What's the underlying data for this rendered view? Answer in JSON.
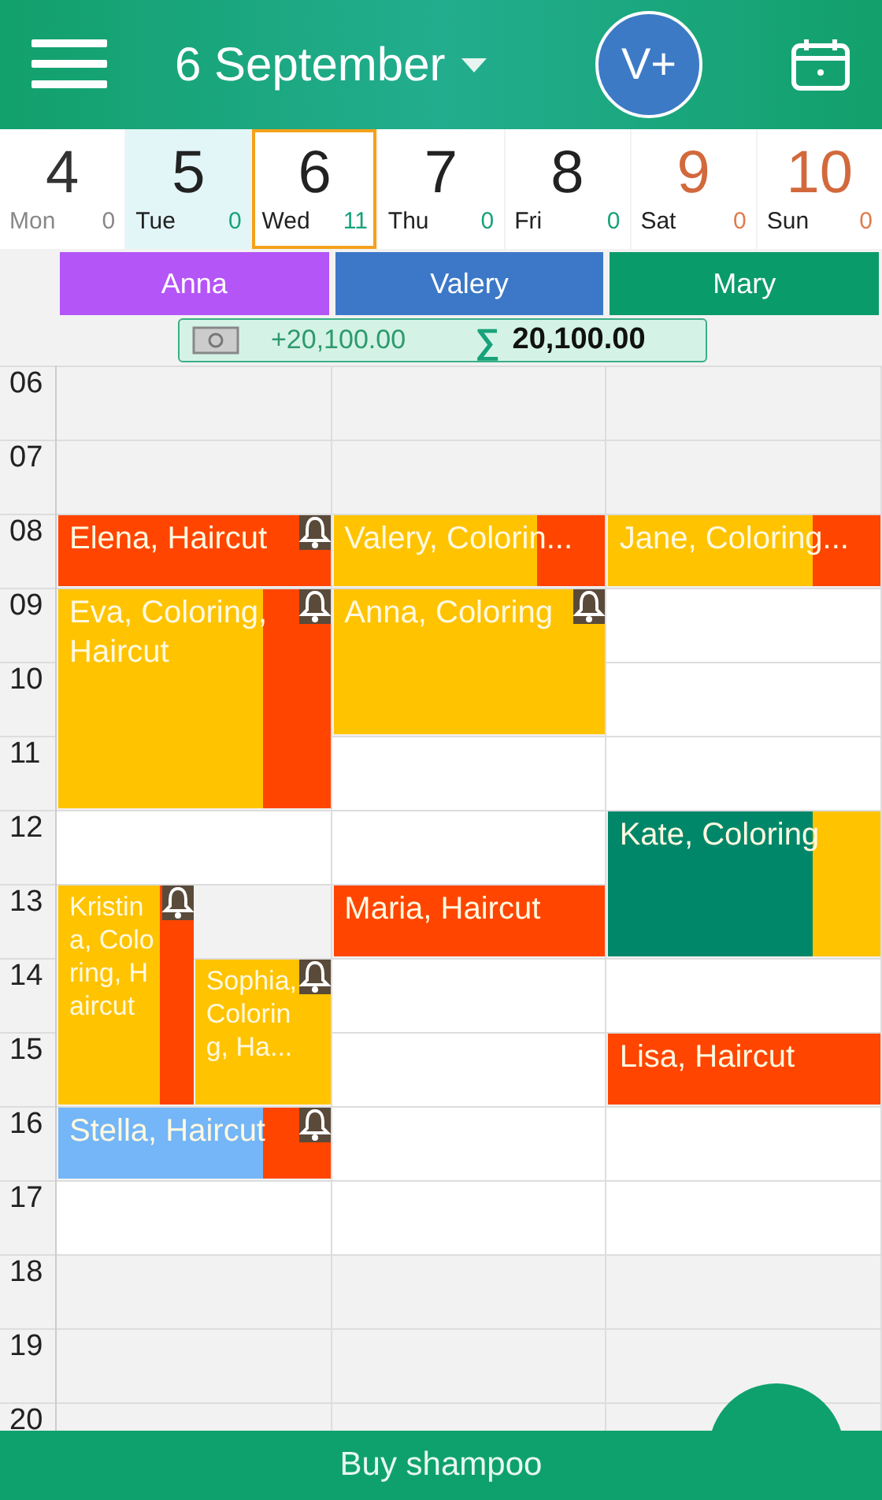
{
  "header": {
    "title": "6 September",
    "avatar": "V+"
  },
  "days": [
    {
      "number": "4",
      "weekday": "Mon",
      "count": "0",
      "kind": "past",
      "today": false,
      "selected": false
    },
    {
      "number": "5",
      "weekday": "Tue",
      "count": "0",
      "kind": "weekday",
      "today": true,
      "selected": false
    },
    {
      "number": "6",
      "weekday": "Wed",
      "count": "11",
      "kind": "weekday",
      "today": false,
      "selected": true
    },
    {
      "number": "7",
      "weekday": "Thu",
      "count": "0",
      "kind": "weekday",
      "today": false,
      "selected": false
    },
    {
      "number": "8",
      "weekday": "Fri",
      "count": "0",
      "kind": "weekday",
      "today": false,
      "selected": false
    },
    {
      "number": "9",
      "weekday": "Sat",
      "count": "0",
      "kind": "weekend",
      "today": false,
      "selected": false
    },
    {
      "number": "10",
      "weekday": "Sun",
      "count": "0",
      "kind": "weekend",
      "today": false,
      "selected": false
    }
  ],
  "summary": {
    "income": "+20,100.00",
    "sum_sign": "∑",
    "total": "20,100.00"
  },
  "hours": [
    "06",
    "07",
    "08",
    "09",
    "10",
    "11",
    "12",
    "13",
    "14",
    "15",
    "16",
    "17",
    "18",
    "19",
    "20"
  ],
  "staff": [
    {
      "name": "Anna",
      "color": "#b455f7",
      "slots": [
        {
          "kind": "off"
        },
        {
          "kind": "off"
        },
        {
          "kind": "appointment",
          "text": "Elena, Haircut",
          "color": "#ff4500",
          "bell": true
        },
        {
          "kind": "appointment",
          "text": "Eva, Coloring, Haircut",
          "color": "#ffc300",
          "status": {
            "color": "#ff4500"
          },
          "bell": true
        },
        {
          "kind": "continued"
        },
        {
          "kind": "continued"
        },
        {
          "kind": "free"
        },
        {
          "kind": "split",
          "lanes": [
            [
              {
                "kind": "appointment",
                "text": "Kristina, Coloring, Haircut",
                "color": "#ffc300",
                "status": {
                  "color": "#ff4500"
                },
                "bell": true
              },
              {
                "kind": "continued"
              },
              {
                "kind": "continued"
              }
            ],
            [
              {
                "kind": "off"
              },
              {
                "kind": "appointment",
                "text": "Sophia, Coloring, Ha...",
                "color": "#ffc300",
                "bell": true
              },
              {
                "kind": "continued"
              }
            ]
          ]
        },
        {
          "kind": "continued"
        },
        {
          "kind": "continued"
        },
        {
          "kind": "appointment",
          "text": "Stella, Haircut",
          "color": "#74b6f7",
          "status": {
            "color": "#ff4500"
          },
          "bell": true
        },
        {
          "kind": "free"
        },
        {
          "kind": "off"
        },
        {
          "kind": "off"
        },
        {
          "kind": "off"
        }
      ]
    },
    {
      "name": "Valery",
      "color": "#3d78c8",
      "slots": [
        {
          "kind": "off"
        },
        {
          "kind": "off"
        },
        {
          "kind": "appointment",
          "text": "Valery, Colorin...",
          "color": "#ffc300",
          "status": {
            "color": "#ff4500"
          },
          "bell": false
        },
        {
          "kind": "appointment",
          "text": "Anna, Coloring",
          "color": "#ffc300",
          "bell": true
        },
        {
          "kind": "continued"
        },
        {
          "kind": "free"
        },
        {
          "kind": "free"
        },
        {
          "kind": "appointment",
          "text": "Maria, Haircut",
          "color": "#ff4500",
          "bell": false
        },
        {
          "kind": "free"
        },
        {
          "kind": "free"
        },
        {
          "kind": "free"
        },
        {
          "kind": "free"
        },
        {
          "kind": "off"
        },
        {
          "kind": "off"
        },
        {
          "kind": "off"
        }
      ]
    },
    {
      "name": "Mary",
      "color": "#0a9b6a",
      "slots": [
        {
          "kind": "off"
        },
        {
          "kind": "off"
        },
        {
          "kind": "appointment",
          "text": "Jane, Coloring...",
          "color": "#ffc300",
          "status": {
            "color": "#ff4500"
          },
          "bell": false
        },
        {
          "kind": "free"
        },
        {
          "kind": "free"
        },
        {
          "kind": "free"
        },
        {
          "kind": "appointment",
          "text": "Kate, Coloring",
          "color": "#00876a",
          "status": {
            "color": "#ffc300"
          },
          "bell": false
        },
        {
          "kind": "continued"
        },
        {
          "kind": "free"
        },
        {
          "kind": "appointment",
          "text": "Lisa, Haircut",
          "color": "#ff4500",
          "bell": false
        },
        {
          "kind": "free"
        },
        {
          "kind": "free"
        },
        {
          "kind": "off"
        },
        {
          "kind": "off"
        },
        {
          "kind": "off"
        }
      ]
    }
  ],
  "bottom_bar": {
    "label": "Buy shampoo"
  }
}
